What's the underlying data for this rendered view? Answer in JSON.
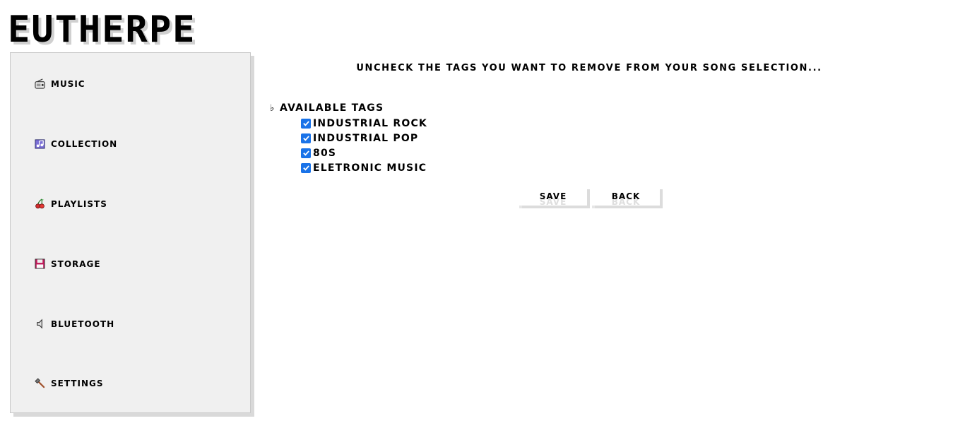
{
  "app": {
    "logo": "EUTHERPE"
  },
  "sidebar": {
    "items": [
      {
        "label": "MUSIC",
        "icon": "radio-icon"
      },
      {
        "label": "COLLECTION",
        "icon": "music-notes-icon"
      },
      {
        "label": "PLAYLISTS",
        "icon": "cherries-icon"
      },
      {
        "label": "STORAGE",
        "icon": "floppy-disk-icon"
      },
      {
        "label": "BLUETOOTH",
        "icon": "speaker-icon"
      },
      {
        "label": "SETTINGS",
        "icon": "hammer-icon"
      }
    ]
  },
  "main": {
    "heading": "UNCHECK THE TAGS YOU WANT TO REMOVE FROM YOUR SONG SELECTION...",
    "tree": {
      "root_symbol": "♭",
      "root_label": "AVAILABLE TAGS",
      "tags": [
        {
          "label": "INDUSTRIAL ROCK",
          "checked": true
        },
        {
          "label": "INDUSTRIAL POP",
          "checked": true
        },
        {
          "label": "80S",
          "checked": true
        },
        {
          "label": "ELETRONIC MUSIC",
          "checked": true
        }
      ]
    },
    "buttons": {
      "save": "SAVE",
      "back": "BACK"
    }
  },
  "colors": {
    "checkbox": "#1a73e8",
    "sidebar_bg": "#f0f0f0"
  }
}
